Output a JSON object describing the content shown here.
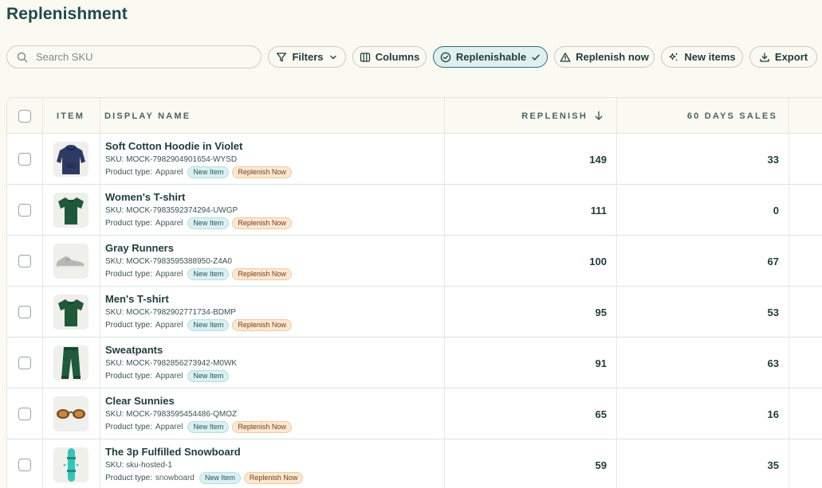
{
  "page": {
    "title": "Replenishment"
  },
  "search": {
    "placeholder": "Search SKU"
  },
  "toolbar": {
    "filters": "Filters",
    "columns": "Columns",
    "replenishable": "Replenishable",
    "replenish_now": "Replenish now",
    "new_items": "New items",
    "export": "Export"
  },
  "table": {
    "headers": {
      "item": "ITEM",
      "display_name": "DISPLAY NAME",
      "replenish": "REPLENISH",
      "sales_60": "60 DAYS SALES"
    },
    "sku_label": "SKU:",
    "ptype_label": "Product type:",
    "rows": [
      {
        "name": "Soft Cotton Hoodie in Violet",
        "sku": "MOCK-7982904901654-WYSD",
        "product_type": "Apparel",
        "badges": [
          "New Item",
          "Replenish Now"
        ],
        "replenish": "149",
        "sales_60": "33",
        "image": "hoodie-icon"
      },
      {
        "name": "Women's T-shirt",
        "sku": "MOCK-7983592374294-UWGP",
        "product_type": "Apparel",
        "badges": [
          "New Item",
          "Replenish Now"
        ],
        "replenish": "111",
        "sales_60": "0",
        "image": "tshirt-icon"
      },
      {
        "name": "Gray Runners",
        "sku": "MOCK-7983595388950-Z4A0",
        "product_type": "Apparel",
        "badges": [
          "New Item",
          "Replenish Now"
        ],
        "replenish": "100",
        "sales_60": "67",
        "image": "shoe-icon"
      },
      {
        "name": "Men's T-shirt",
        "sku": "MOCK-7982902771734-BDMP",
        "product_type": "Apparel",
        "badges": [
          "New Item",
          "Replenish Now"
        ],
        "replenish": "95",
        "sales_60": "53",
        "image": "tshirt-icon"
      },
      {
        "name": "Sweatpants",
        "sku": "MOCK-7982856273942-M0WK",
        "product_type": "Apparel",
        "badges": [
          "New Item"
        ],
        "replenish": "91",
        "sales_60": "63",
        "image": "pants-icon"
      },
      {
        "name": "Clear Sunnies",
        "sku": "MOCK-7983595454486-QMOZ",
        "product_type": "Apparel",
        "badges": [
          "New Item",
          "Replenish Now"
        ],
        "replenish": "65",
        "sales_60": "16",
        "image": "sunglasses-icon"
      },
      {
        "name": "The 3p Fulfilled Snowboard",
        "sku": "sku-hosted-1",
        "product_type": "snowboard",
        "badges": [
          "New Item",
          "Replenish Now"
        ],
        "replenish": "59",
        "sales_60": "35",
        "image": "snowboard-icon"
      }
    ]
  },
  "colors": {
    "background": "#fbfaf2",
    "accent": "#2e6f74",
    "new_badge": "#dbf0f1",
    "replenish_badge": "#fbe8d3"
  }
}
